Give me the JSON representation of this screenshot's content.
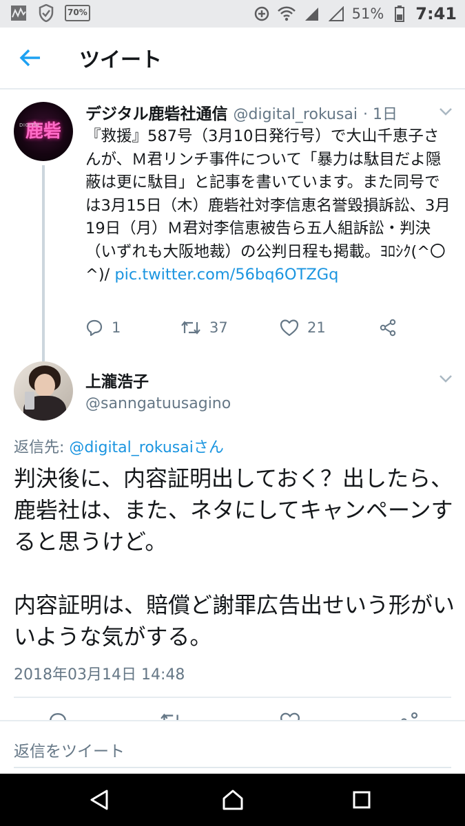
{
  "status_bar": {
    "battery_saver_label": "70%",
    "battery_percent": "51%",
    "time": "7:41",
    "icons": [
      "activity-icon",
      "shield-check-icon",
      "battery-saver-icon",
      "data-saver-icon",
      "wifi-icon",
      "signal-icon",
      "signal-empty-icon",
      "battery-icon"
    ]
  },
  "app_bar": {
    "title": "ツイート",
    "back_icon": "arrow-left-icon"
  },
  "parent_tweet": {
    "display_name": "デジタル鹿砦社通信",
    "handle": "@digital_rokusai",
    "time_ago": "· 1日",
    "avatar_logo": "鹿砦",
    "avatar_logo_sub": "DIGITAL",
    "text": "『救援』587号（3月10日発行号）で大山千恵子さんが、Ｍ君リンチ事件について「暴力は駄目だよ隠蔽は更に駄目」と記事を書いています。また同号では3月15日（木）鹿砦社対李信恵名誉毀損訴訟、3月19日（月）Ｍ君対李信恵被告ら五人組訴訟・判決（いずれも大阪地裁）の公判日程も掲載。ﾖﾛｼｸ(^〇^)/ ",
    "link": "pic.twitter.com/56bq6OTZGq",
    "replies": "1",
    "retweets": "37",
    "likes": "21"
  },
  "reply_tweet": {
    "display_name": "上瀧浩子",
    "handle": "@sanngatuusagino",
    "reply_to_prefix": "返信先: ",
    "reply_to_link": "@digital_rokusaiさん",
    "text": "判決後に、内容証明出しておく？出したら、鹿砦社は、また、ネタにしてキャンペーンすると思うけど。\n\n内容証明は、賠償ど謝罪広告出せいう形がいいような気がする。",
    "timestamp": "2018年03月14日 14:48"
  },
  "composer": {
    "placeholder": "返信をツイート"
  },
  "colors": {
    "link": "#1b95e0",
    "secondary_text": "#657786",
    "primary_text": "#14171a",
    "status_bar_bg": "#e9eaec",
    "nav_bar_bg": "#000000"
  }
}
